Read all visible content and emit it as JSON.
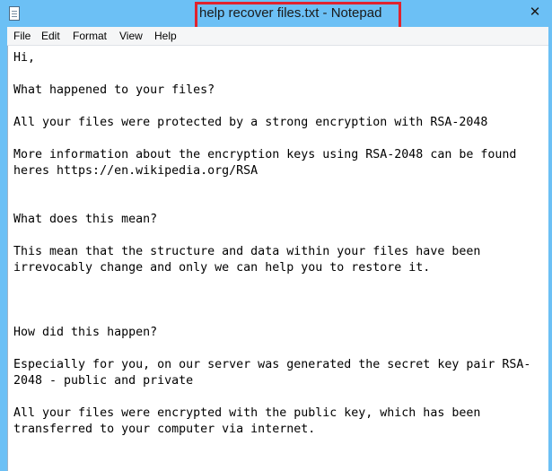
{
  "window": {
    "title": "help recover files.txt - Notepad",
    "close_glyph": "✕"
  },
  "menu": {
    "items": [
      "File",
      "Edit",
      "Format",
      "View",
      "Help"
    ]
  },
  "document": {
    "text": "Hi,\n\nWhat happened to your files?\n\nAll your files were protected by a strong encryption with RSA-2048\n\nMore information about the encryption keys using RSA-2048 can be found\nheres https://en.wikipedia.org/RSA\n\n\nWhat does this mean?\n\nThis mean that the structure and data within your files have been\nirrevocably change and only we can help you to restore it.\n\n\n\nHow did this happen?\n\nEspecially for you, on our server was generated the secret key pair RSA-\n2048 - public and private\n\nAll your files were encrypted with the public key, which has been\ntransferred to your computer via internet."
  },
  "colors": {
    "titlebar": "#6cc0f5",
    "highlight": "#e0232e"
  }
}
